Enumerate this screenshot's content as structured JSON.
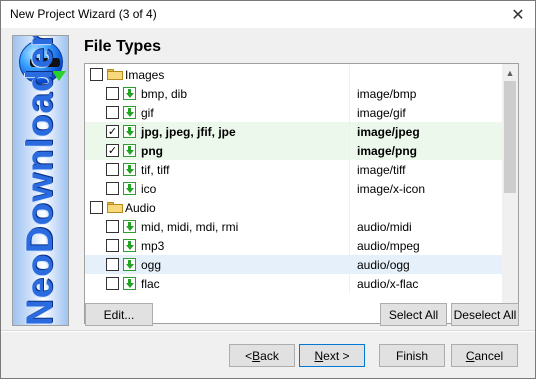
{
  "window": {
    "title": "New Project Wizard (3 of 4)",
    "close_glyph": "✕"
  },
  "sidebar": {
    "brand_text": "NeoDownloader"
  },
  "page": {
    "heading": "File Types"
  },
  "file_list": {
    "rows": [
      {
        "type": "group",
        "label": "Images",
        "mime": "",
        "checked": false,
        "bold": false,
        "icon": "folder-icon"
      },
      {
        "type": "item",
        "label": "bmp, dib",
        "mime": "image/bmp",
        "checked": false,
        "bold": false,
        "icon": "download-icon"
      },
      {
        "type": "item",
        "label": "gif",
        "mime": "image/gif",
        "checked": false,
        "bold": false,
        "icon": "download-icon"
      },
      {
        "type": "item",
        "label": "jpg, jpeg, jfif, jpe",
        "mime": "image/jpeg",
        "checked": true,
        "bold": true,
        "icon": "download-icon"
      },
      {
        "type": "item",
        "label": "png",
        "mime": "image/png",
        "checked": true,
        "bold": true,
        "icon": "download-icon"
      },
      {
        "type": "item",
        "label": "tif, tiff",
        "mime": "image/tiff",
        "checked": false,
        "bold": false,
        "icon": "download-icon"
      },
      {
        "type": "item",
        "label": "ico",
        "mime": "image/x-icon",
        "checked": false,
        "bold": false,
        "icon": "download-icon"
      },
      {
        "type": "group",
        "label": "Audio",
        "mime": "",
        "checked": false,
        "bold": false,
        "icon": "folder-icon"
      },
      {
        "type": "item",
        "label": "mid, midi, mdi, rmi",
        "mime": "audio/midi",
        "checked": false,
        "bold": false,
        "icon": "download-icon"
      },
      {
        "type": "item",
        "label": "mp3",
        "mime": "audio/mpeg",
        "checked": false,
        "bold": false,
        "icon": "download-icon"
      },
      {
        "type": "item",
        "label": "ogg",
        "mime": "audio/ogg",
        "checked": false,
        "bold": false,
        "icon": "download-icon"
      },
      {
        "type": "item",
        "label": "flac",
        "mime": "audio/x-flac",
        "checked": false,
        "bold": false,
        "icon": "download-icon"
      }
    ],
    "check_glyph": "✓",
    "scroll_up_glyph": "▲",
    "scroll_down_glyph": "▼"
  },
  "buttons": {
    "edit": "Edit...",
    "select_all": "Select All",
    "deselect_all": "Deselect All",
    "back_arrow": "< ",
    "back_mnemonic": "B",
    "back_rest": "ack",
    "next_mnemonic": "N",
    "next_rest": "ext >",
    "finish": "Finish",
    "cancel_mnemonic": "C",
    "cancel_rest": "ancel"
  },
  "colors": {
    "checked_row_bg": "#edf8ec",
    "hover_row_bg": "#e6f0fa",
    "default_button_border": "#0078d7"
  }
}
